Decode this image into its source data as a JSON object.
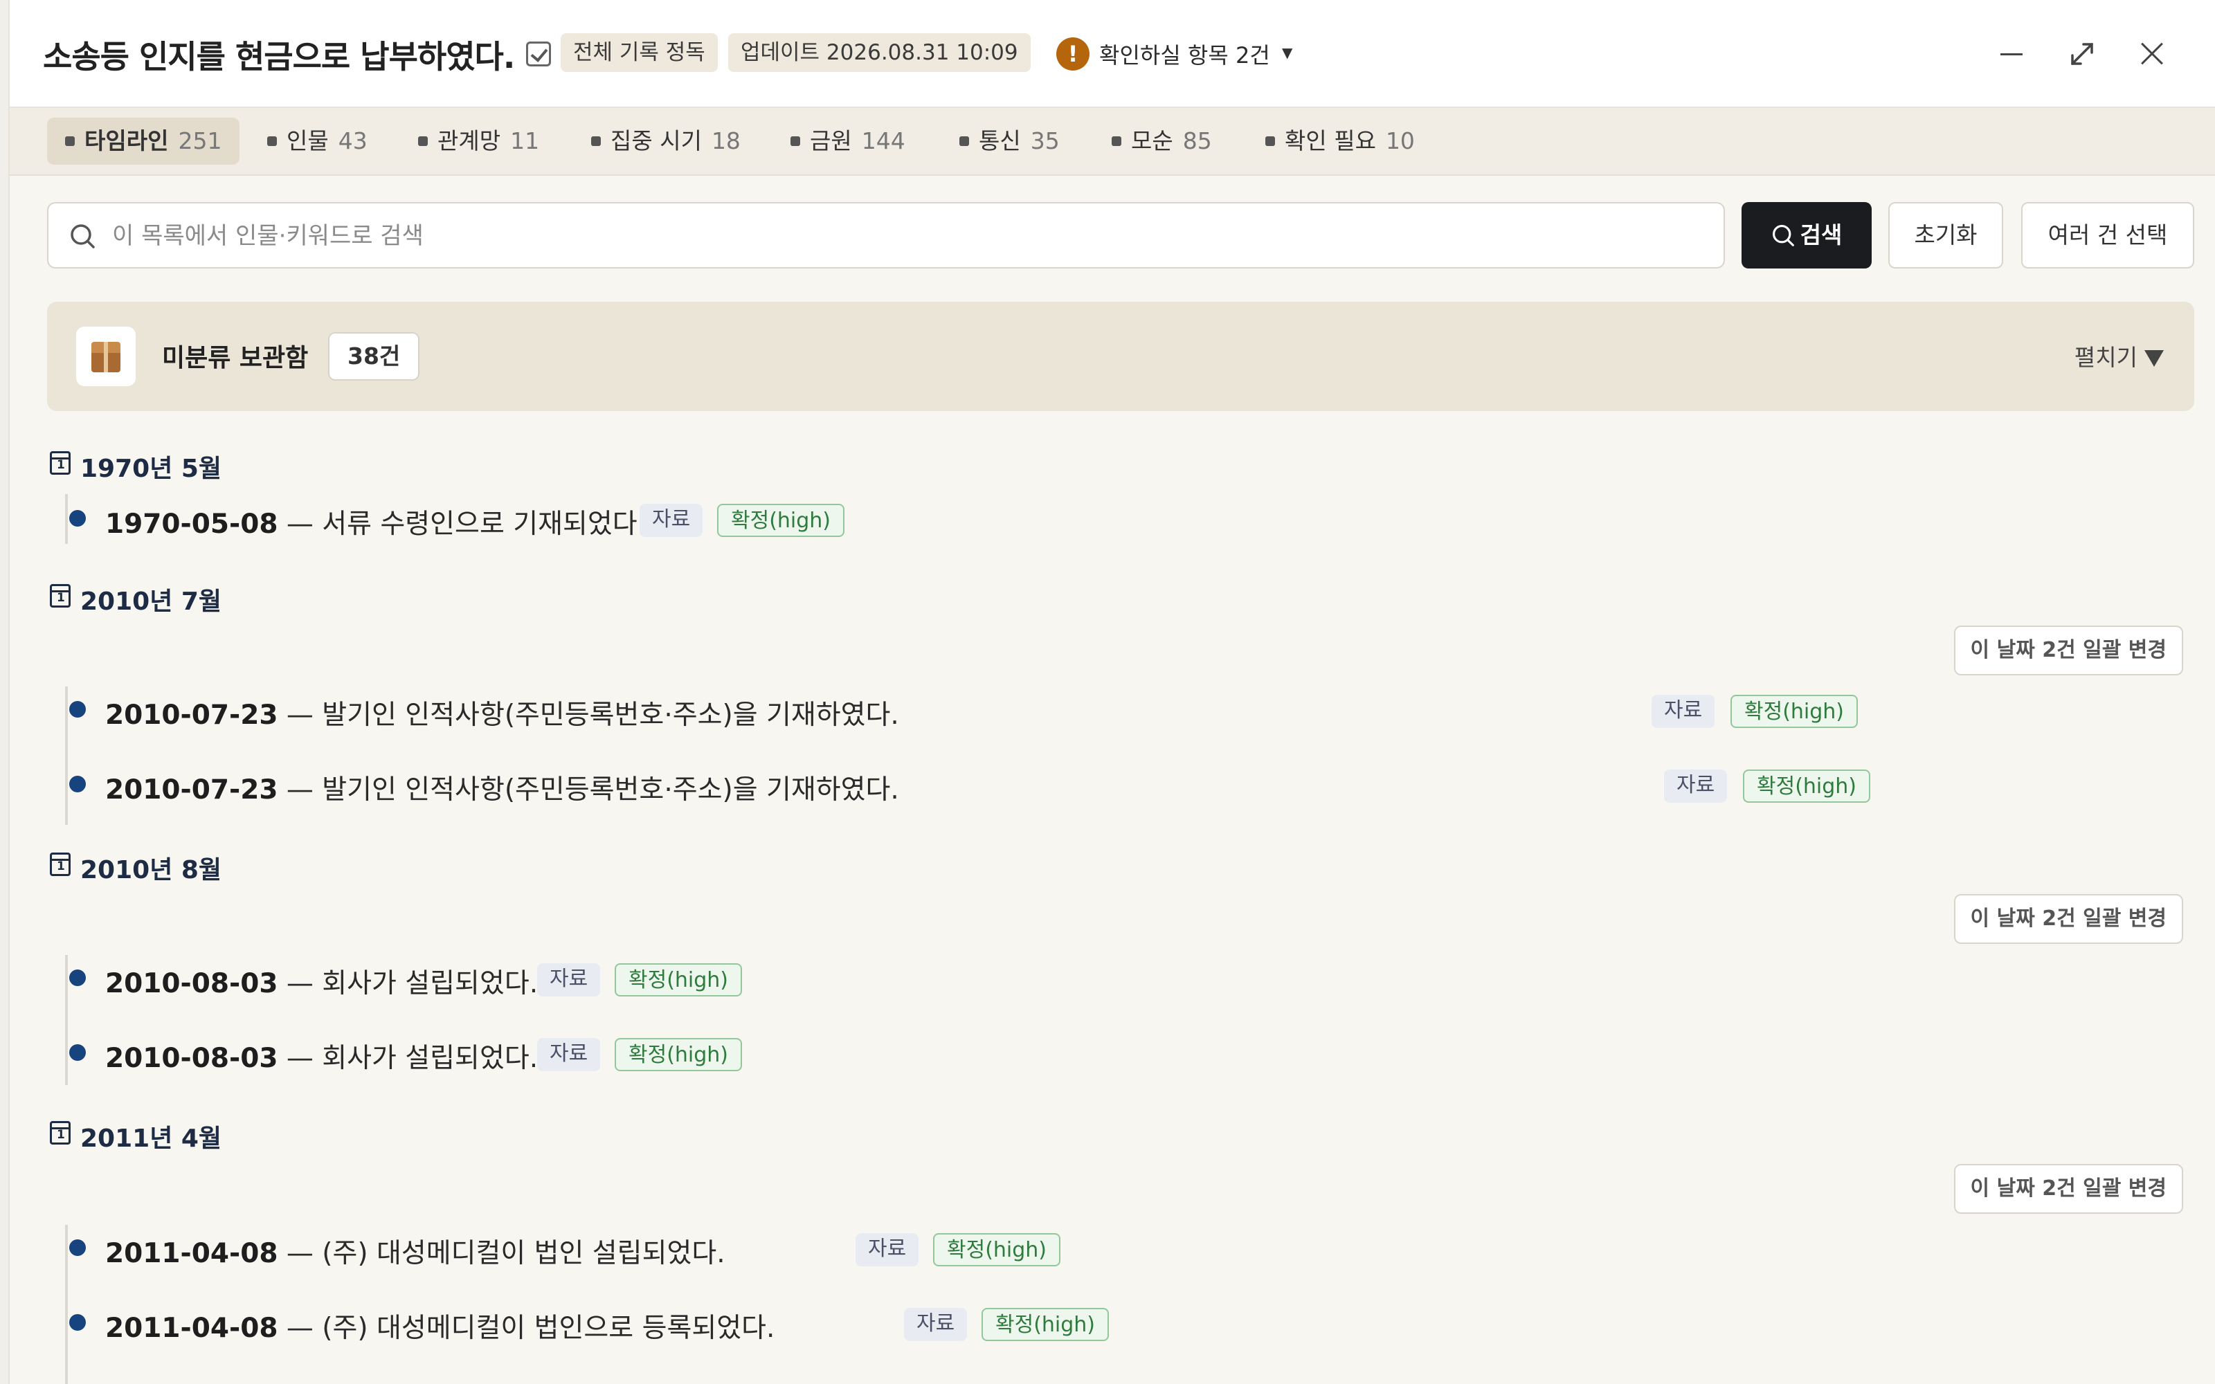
{
  "header": {
    "title": "소송등 인지를 현금으로 납부하였다.",
    "full_record_label": "전체 기록 정독",
    "update_label": "업데이트 2026.08.31 10:09",
    "warning_label": "확인하실 항목 2건",
    "warning_glyph": "!"
  },
  "tabs": [
    {
      "label": "타임라인",
      "count": "251"
    },
    {
      "label": "인물",
      "count": "43"
    },
    {
      "label": "관계망",
      "count": "11"
    },
    {
      "label": "집중 시기",
      "count": "18"
    },
    {
      "label": "금원",
      "count": "144"
    },
    {
      "label": "통신",
      "count": "35"
    },
    {
      "label": "모순",
      "count": "85"
    },
    {
      "label": "확인 필요",
      "count": "10"
    }
  ],
  "search": {
    "placeholder": "이 목록에서 인물·키워드로 검색",
    "search_label": "검색",
    "reset_label": "초기화",
    "multi_label": "여러 건 선택"
  },
  "bin": {
    "label": "미분류 보관함",
    "count": "38건",
    "expand_label": "펼치기"
  },
  "groups": [
    {
      "month": "1970년 5월",
      "bulk": "",
      "events": [
        {
          "date": "1970-05-08",
          "text": " — 서류 수령인으로 기재되었다.",
          "src": "자료",
          "conf": "확정(high)"
        }
      ]
    },
    {
      "month": "2010년 7월",
      "bulk": "이 날짜 2건 일괄 변경",
      "events": [
        {
          "date": "2010-07-23",
          "text": " — 발기인 인적사항(주민등록번호·주소)을 기재하였다.",
          "src": "자료",
          "conf": "확정(high)"
        },
        {
          "date": "2010-07-23",
          "text": " — 발기인 인적사항(주민등록번호·주소)을 기재하였다.",
          "src": "자료",
          "conf": "확정(high)"
        }
      ]
    },
    {
      "month": "2010년 8월",
      "bulk": "이 날짜 2건 일괄 변경",
      "events": [
        {
          "date": "2010-08-03",
          "text": " — 회사가 설립되었다.",
          "src": "자료",
          "conf": "확정(high)"
        },
        {
          "date": "2010-08-03",
          "text": " — 회사가 설립되었다.",
          "src": "자료",
          "conf": "확정(high)"
        }
      ]
    },
    {
      "month": "2011년 4월",
      "bulk": "이 날짜 2건 일괄 변경",
      "events": [
        {
          "date": "2011-04-08",
          "text": " — (주) 대성메디컬이 법인 설립되었다.",
          "src": "자료",
          "conf": "확정(high)"
        },
        {
          "date": "2011-04-08",
          "text": " — (주) 대성메디컬이 법인으로 등록되었다.",
          "src": "자료",
          "conf": "확정(high)"
        }
      ]
    }
  ]
}
